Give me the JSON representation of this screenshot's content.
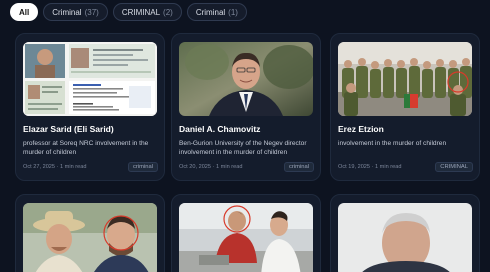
{
  "filters": [
    {
      "label": "All",
      "count": ""
    },
    {
      "label": "Criminal",
      "count": "(37)"
    },
    {
      "label": "CRIMINAL",
      "count": "(2)"
    },
    {
      "label": "Criminal",
      "count": "(1)"
    }
  ],
  "cards": [
    {
      "title": "Elazar Sarid (Eli Sarid)",
      "description": "professor at Soreq NRC involvement in the murder of children",
      "meta": "Oct 27, 2025 · 1 min read",
      "tag": "criminal"
    },
    {
      "title": "Daniel A. Chamovitz",
      "description": "Ben-Gurion University of the Negev director involvement in the murder of children",
      "meta": "Oct 20, 2025 · 1 min read",
      "tag": "criminal"
    },
    {
      "title": "Erez Etzion",
      "description": "involvement in the murder of children",
      "meta": "Oct 19, 2025 · 1 min read",
      "tag": "CRIMINAL"
    }
  ],
  "doc_snippet": {
    "line1": "Elazar Sarid",
    "line2": "Eli Sarid"
  },
  "colors": {
    "background": "#0d1320",
    "card": "#141c2c",
    "chip_active": "#ffffff"
  }
}
